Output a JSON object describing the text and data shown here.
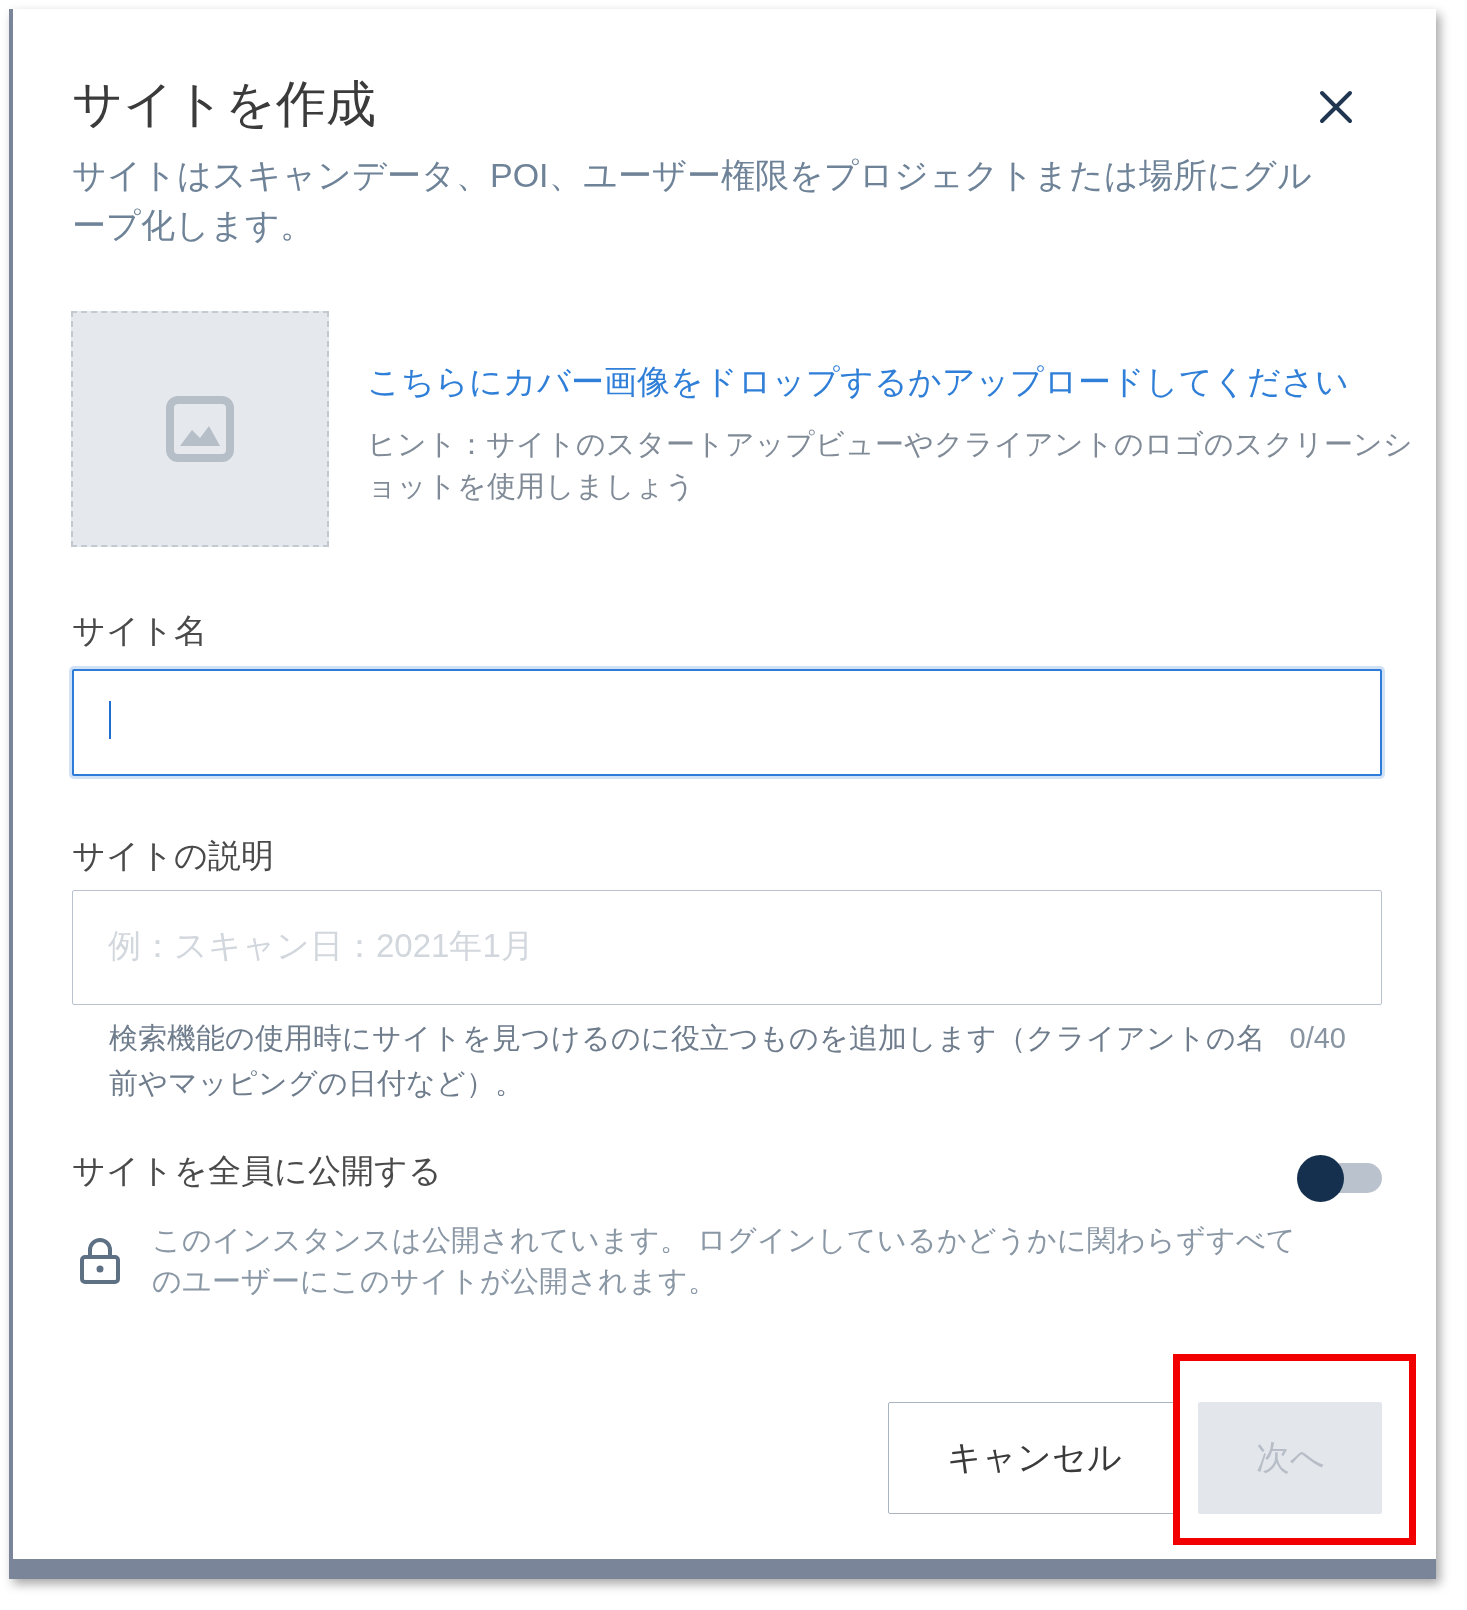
{
  "dialog": {
    "title": "サイトを作成",
    "description": "サイトはスキャンデータ、POI、ユーザー権限をプロジェクトまたは場所にグループ化します。"
  },
  "cover_upload": {
    "prompt": "こちらにカバー画像をドロップするかアップロードしてください",
    "hint": "ヒント：サイトのスタートアップビューやクライアントのロゴのスクリーンショットを使用しましょう"
  },
  "site_name": {
    "label": "サイト名",
    "focused": true
  },
  "site_description": {
    "label": "サイトの説明",
    "placeholder": "例：スキャン日：2021年1月",
    "help": "検索機能の使用時にサイトを見つけるのに役立つものを追加します（クライアントの名前やマッピングの日付など）。",
    "counter": "0/40"
  },
  "visibility": {
    "label": "サイトを全員に公開する",
    "on": false,
    "notice": "このインスタンスは公開されています。 ログインしているかどうかに関わらずすべてのユーザーにこのサイトが公開されます。"
  },
  "buttons": [
    {
      "label": "キャンセル",
      "kind": "secondary",
      "disabled": false,
      "highlighted": false
    },
    {
      "label": "次へ",
      "kind": "primary",
      "disabled": true,
      "highlighted": true
    }
  ]
}
